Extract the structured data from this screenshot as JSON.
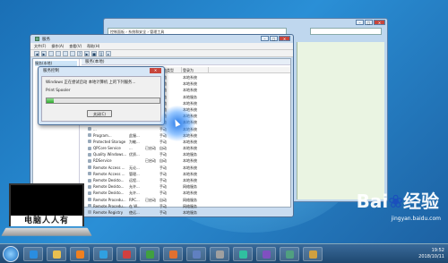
{
  "back_window": {
    "address": "控制面板 › 系统和安全 › 管理工具"
  },
  "services_window": {
    "title": "服务",
    "menu": [
      "文件(F)",
      "操作(A)",
      "查看(V)",
      "帮助(H)"
    ],
    "tree": [
      "服务(本地)"
    ],
    "list_header": "服务(本地)",
    "columns": [
      "名称",
      "描述",
      "状态",
      "启动类型",
      "登录为"
    ],
    "rows": [
      {
        "name": "...Key",
        "desc": "提供...",
        "state": "已启动",
        "start": "手动",
        "logon": "本地系统"
      },
      {
        "name": "...n Bro...",
        "desc": "PnP-...",
        "state": "已启动",
        "start": "自动",
        "logon": "本地系统"
      },
      {
        "name": "...ion Ex...",
        "desc": "负责...",
        "state": "",
        "start": "手动",
        "logon": "本地系统"
      },
      {
        "name": "...Device...",
        "desc": "使用...",
        "state": "",
        "start": "手动",
        "logon": "本地服务"
      },
      {
        "name": "...r...",
        "desc": "",
        "state": "",
        "start": "手动",
        "logon": "本地系统"
      },
      {
        "name": "...Eve...",
        "desc": "",
        "state": "",
        "start": "手动",
        "logon": "本地系统"
      },
      {
        "name": "...",
        "desc": "",
        "state": "",
        "start": "手动",
        "logon": "本地系统"
      },
      {
        "name": "...",
        "desc": "",
        "state": "",
        "start": "手动",
        "logon": "本地系统"
      },
      {
        "name": "...",
        "desc": "",
        "state": "",
        "start": "手动",
        "logon": "本地系统"
      },
      {
        "name": "Program...",
        "desc": "此服...",
        "state": "",
        "start": "手动",
        "logon": "本地系统"
      },
      {
        "name": "Protected Storage",
        "desc": "为敏...",
        "state": "",
        "start": "手动",
        "logon": "本地系统"
      },
      {
        "name": "QPCore Service",
        "desc": "...",
        "state": "已启动",
        "start": "自动",
        "logon": "本地系统"
      },
      {
        "name": "Quality Windows...",
        "desc": "优质...",
        "state": "",
        "start": "手动",
        "logon": "本地服务"
      },
      {
        "name": "RDService",
        "desc": "",
        "state": "已启动",
        "start": "自动",
        "logon": "本地系统"
      },
      {
        "name": "Remote Access ...",
        "desc": "无论...",
        "state": "",
        "start": "手动",
        "logon": "本地系统"
      },
      {
        "name": "Remote Access ...",
        "desc": "管理...",
        "state": "",
        "start": "手动",
        "logon": "本地系统"
      },
      {
        "name": "Remote Deskto...",
        "desc": "远程...",
        "state": "",
        "start": "手动",
        "logon": "本地系统"
      },
      {
        "name": "Remote Deskto...",
        "desc": "允许...",
        "state": "",
        "start": "手动",
        "logon": "网络服务"
      },
      {
        "name": "Remote Deskto...",
        "desc": "允许...",
        "state": "",
        "start": "手动",
        "logon": "本地系统"
      },
      {
        "name": "Remote Procedu...",
        "desc": "RPC...",
        "state": "已启动",
        "start": "自动",
        "logon": "网络服务"
      },
      {
        "name": "Remote Procedu...",
        "desc": "在 W...",
        "state": "",
        "start": "手动",
        "logon": "网络服务"
      },
      {
        "name": "Remote Registry",
        "desc": "使远...",
        "state": "",
        "start": "手动",
        "logon": "本地服务"
      }
    ],
    "tabs": [
      "扩展",
      "标准"
    ]
  },
  "dialog": {
    "title": "服务控制",
    "message": "Windows 正在尝试启动 本地计算机 上的下列服务...",
    "service": "Print Spooler",
    "progress": 0.06,
    "close_button": "关闭(C)"
  },
  "logo_text": "电脑人人有",
  "watermark": {
    "brand": "Bai",
    "brand2": "经验",
    "url": "jingyan.baidu.com"
  },
  "taskbar": {
    "time": "19:52",
    "date": "2018/10/11",
    "apps": [
      {
        "icon": "ie-icon",
        "color": "#2a8de0"
      },
      {
        "icon": "folder-icon",
        "color": "#e8c050"
      },
      {
        "icon": "media-player-icon",
        "color": "#f08020"
      },
      {
        "icon": "qq-icon",
        "color": "#30a0e0"
      },
      {
        "icon": "game-icon",
        "color": "#d04040"
      },
      {
        "icon": "browser-icon",
        "color": "#40a040"
      },
      {
        "icon": "photo-icon",
        "color": "#e07030"
      },
      {
        "icon": "control-panel-icon",
        "color": "#6080c0"
      },
      {
        "icon": "tool-icon",
        "color": "#a0a0a0"
      },
      {
        "icon": "chat-icon",
        "color": "#30c0a0"
      },
      {
        "icon": "music-icon",
        "color": "#8050c0"
      },
      {
        "icon": "services-icon",
        "color": "#50a080"
      },
      {
        "icon": "snip-icon",
        "color": "#d0a040"
      }
    ]
  }
}
